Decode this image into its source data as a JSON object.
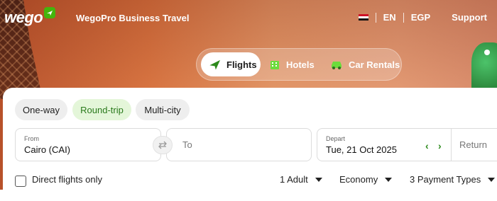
{
  "header": {
    "logo_text": "wego",
    "brand_text": "WegoPro Business Travel",
    "language": "EN",
    "currency": "EGP",
    "support_label": "Support",
    "flag_icon": "egypt-flag-icon"
  },
  "product_tabs": [
    {
      "label": "Flights",
      "icon": "plane-icon",
      "active": true
    },
    {
      "label": "Hotels",
      "icon": "hotel-icon",
      "active": false
    },
    {
      "label": "Car Rentals",
      "icon": "car-icon",
      "active": false
    }
  ],
  "trip_types": [
    {
      "label": "One-way",
      "selected": false
    },
    {
      "label": "Round-trip",
      "selected": true
    },
    {
      "label": "Multi-city",
      "selected": false
    }
  ],
  "search": {
    "from_label": "From",
    "from_value": "Cairo (CAI)",
    "to_placeholder": "To",
    "depart_label": "Depart",
    "depart_value": "Tue, 21 Oct 2025",
    "return_placeholder": "Return"
  },
  "options": {
    "direct_only_label": "Direct flights only",
    "direct_only_checked": false,
    "passengers": "1 Adult",
    "cabin": "Economy",
    "payment": "3 Payment Types"
  },
  "colors": {
    "accent_green": "#44b50c",
    "selected_pill_bg": "#e4f6d9",
    "selected_pill_text": "#2a7a1c"
  }
}
